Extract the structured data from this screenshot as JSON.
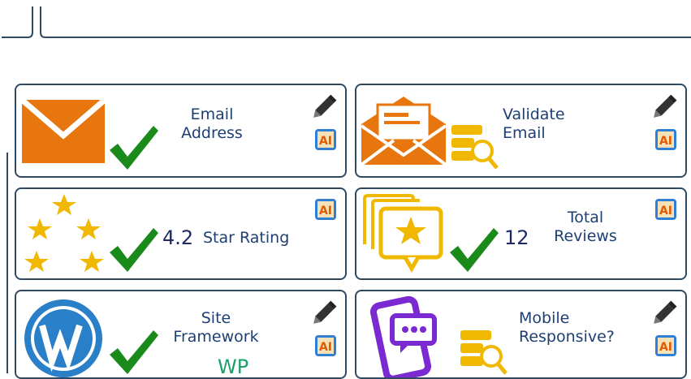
{
  "cards": [
    {
      "label_line1": "Email",
      "label_line2": "Address",
      "icon": "envelope-icon",
      "status": "check-icon"
    },
    {
      "label_line1": "Validate",
      "label_line2": "Email",
      "icon": "open-envelope-icon",
      "secondary_icon": "database-search-icon"
    },
    {
      "value": "4.2",
      "label": "Star Rating",
      "icon": "stars-icon",
      "status": "check-icon"
    },
    {
      "value": "12",
      "label_line1": "Total",
      "label_line2": "Reviews",
      "icon": "review-bubble-icon",
      "status": "check-icon"
    },
    {
      "label_line1": "Site",
      "label_line2": "Framework",
      "value": "WP",
      "icon": "wordpress-icon",
      "status": "check-icon"
    },
    {
      "label_line1": "Mobile",
      "label_line2": "Responsive?",
      "icon": "mobile-chat-icon",
      "secondary_icon": "database-search-icon"
    }
  ],
  "badges": {
    "ai": "AI"
  },
  "colors": {
    "border": "#2e4a63",
    "orange": "#e8760e",
    "gold": "#f0b800",
    "green": "#1a8a1a",
    "wp_blue": "#2a7fc9",
    "purple": "#7a2ad0",
    "text": "#1d3f73"
  }
}
